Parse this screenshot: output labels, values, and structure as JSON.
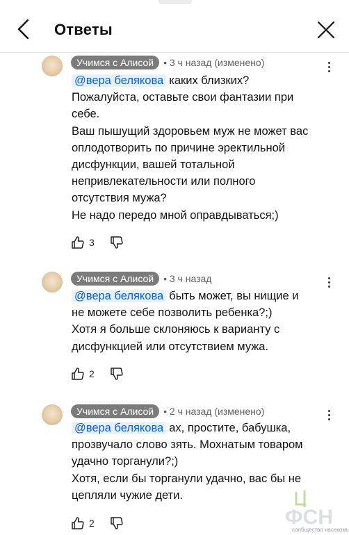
{
  "header": {
    "title": "Ответы",
    "back_icon": "chevron-left-icon",
    "close_icon": "close-icon"
  },
  "comments": [
    {
      "author": "Учимся с Алисой",
      "meta": "• 3 ч назад (изменено)",
      "mention": "@вера белякова",
      "lines": [
        "каких близких?",
        "Пожалуйста, оставьте свои фантазии при",
        "себе.",
        "Ваш пышущий здоровьем муж не может вас",
        "оплодотворить по причине эректильной",
        "дисфункции, вашей тотальной",
        "непривлекательности  или полного",
        "отсутствия мужа?",
        "Не надо передо мной оправдываться;)"
      ],
      "likes": "3"
    },
    {
      "author": "Учимся с Алисой",
      "meta": "• 3 ч назад",
      "mention": "@вера белякова",
      "lines": [
        "быть может, вы нищие и",
        "не можете себе позволить ребенка?;)",
        "Хотя я больше склоняюсь к варианту с",
        "дисфункцией или отсутствием мужа."
      ],
      "likes": "2"
    },
    {
      "author": "Учимся с Алисой",
      "meta": "• 2 ч назад (изменено)",
      "mention": "@вера белякова",
      "lines": [
        "ах, простите, бабушка,",
        "прозвучало слово зять. Мохнатым товаром",
        "удачно торганули?;)",
        "Хотя, если бы торганули удачно, вас бы не",
        "цепляли чужие дети."
      ],
      "likes": "2"
    }
  ],
  "watermark": {
    "logo_text": "ФСН",
    "caption": "сообщество насекомых"
  },
  "colors": {
    "mention": "#065fd4",
    "author_chip": "#7b7b7b",
    "meta": "#5f5f5f"
  }
}
